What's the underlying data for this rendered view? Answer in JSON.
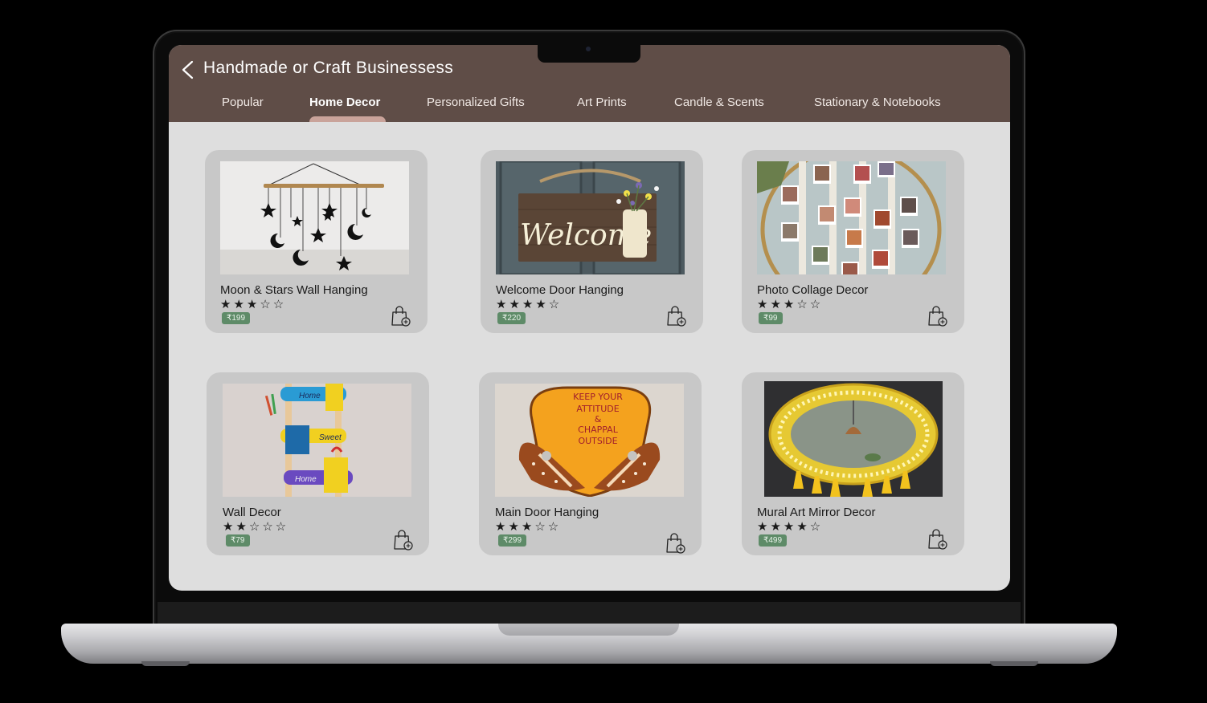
{
  "app": {
    "title": "Handmade or Craft Businessess",
    "tabs": [
      "Popular",
      "Home Decor",
      "Personalized Gifts",
      "Art Prints",
      "Candle & Scents",
      "Stationary & Notebooks"
    ],
    "active_tab": "Home Decor",
    "price_color": "#5e8b68",
    "header_color": "#5f4d47"
  },
  "products": [
    {
      "name": "Moon & Stars Wall Hanging",
      "rating": 3,
      "stars": "★★★☆☆",
      "price": "₹199",
      "image_icon": "moon-stars-hanging"
    },
    {
      "name": "Welcome Door Hanging",
      "rating": 4,
      "stars": "★★★★☆",
      "price": "₹220",
      "image_icon": "welcome-sign",
      "image_text": "Welcome"
    },
    {
      "name": "Photo Collage Decor",
      "rating": 3,
      "stars": "★★★☆☆",
      "price": "₹99",
      "image_icon": "photo-collage"
    },
    {
      "name": "Wall Decor",
      "rating": 2,
      "stars": "★★☆☆☆",
      "price": "₹79",
      "image_icon": "wall-organizer",
      "image_text": [
        "Home",
        "Sweet",
        "Home"
      ]
    },
    {
      "name": "Main Door Hanging",
      "rating": 3,
      "stars": "★★★☆☆",
      "price": "₹299",
      "image_icon": "chappal-sign",
      "image_text": [
        "KEEP YOUR",
        "ATTITUDE",
        "&",
        "CHAPPAL",
        "OUTSIDE"
      ]
    },
    {
      "name": "Mural Art Mirror Decor",
      "rating": 4,
      "stars": "★★★★☆",
      "price": "₹499",
      "image_icon": "mirror-decor"
    }
  ]
}
